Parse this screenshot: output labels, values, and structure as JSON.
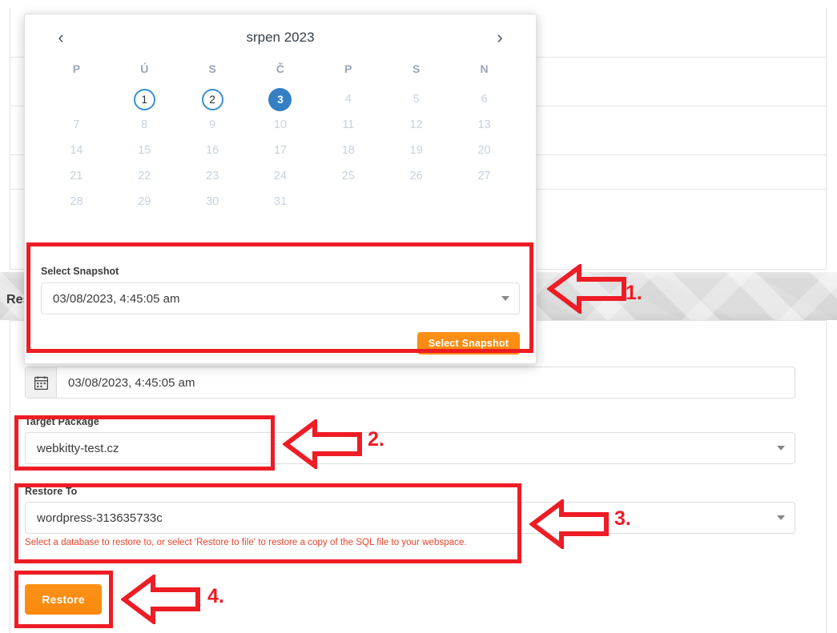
{
  "page": {
    "section_heading": "Res"
  },
  "datepicker": {
    "month_title": "srpen 2023",
    "prev_label": "‹",
    "next_label": "›",
    "weekdays": [
      "P",
      "Ú",
      "S",
      "Č",
      "P",
      "S",
      "N"
    ],
    "lead_blanks": 1,
    "days": [
      1,
      2,
      3,
      4,
      5,
      6,
      7,
      8,
      9,
      10,
      11,
      12,
      13,
      14,
      15,
      16,
      17,
      18,
      19,
      20,
      21,
      22,
      23,
      24,
      25,
      26,
      27,
      28,
      29,
      30,
      31
    ],
    "available_days": [
      1,
      2
    ],
    "selected_day": 3,
    "snapshot": {
      "label": "Select Snapshot",
      "value": "03/08/2023, 4:45:05 am",
      "button_label": "Select Snapshot"
    }
  },
  "form": {
    "date_field": {
      "icon": "calendar-icon",
      "value": "03/08/2023, 4:45:05 am"
    },
    "target_package": {
      "label": "Target Package",
      "value": "webkitty-test.cz"
    },
    "restore_to": {
      "label": "Restore To",
      "value": "wordpress-313635733c",
      "help": "Select a database to restore to, or select 'Restore to file' to restore a copy of the SQL file to your webspace."
    },
    "restore_button": "Restore"
  },
  "annotations": [
    {
      "number": "1."
    },
    {
      "number": "2."
    },
    {
      "number": "3."
    },
    {
      "number": "4."
    }
  ],
  "colors": {
    "accent_orange": "#f98a0e",
    "accent_blue": "#3580c4",
    "annotation_red": "#ee1c25",
    "help_red": "#e8442b"
  }
}
